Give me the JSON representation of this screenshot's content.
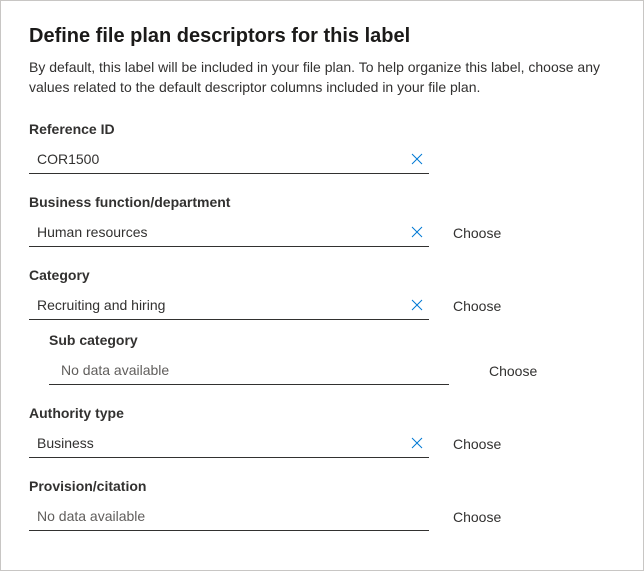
{
  "heading": "Define file plan descriptors for this label",
  "description": "By default, this label will be included in your file plan. To help organize this label, choose any values related to the default descriptor columns included in your file plan.",
  "fields": {
    "referenceId": {
      "label": "Reference ID",
      "value": "COR1500"
    },
    "businessFunction": {
      "label": "Business function/department",
      "value": "Human resources",
      "choose": "Choose"
    },
    "category": {
      "label": "Category",
      "value": "Recruiting and hiring",
      "choose": "Choose"
    },
    "subCategory": {
      "label": "Sub category",
      "value": "No data available",
      "choose": "Choose"
    },
    "authorityType": {
      "label": "Authority type",
      "value": "Business",
      "choose": "Choose"
    },
    "provisionCitation": {
      "label": "Provision/citation",
      "value": "No data available",
      "choose": "Choose"
    }
  }
}
